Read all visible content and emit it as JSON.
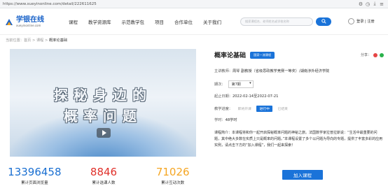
{
  "browser": {
    "url": "https://www.xueyinonline.com/detail/222611625"
  },
  "header": {
    "logo_name": "学银在线",
    "logo_domain": "xueyinonline.com",
    "menu": [
      "课程",
      "教学资源库",
      "示范教学包",
      "项目",
      "合作单位",
      "关于我们"
    ],
    "search_placeholder": "搜索课程名、老师姓名或学校名称",
    "login_label": "登录 | 注册"
  },
  "breadcrumb": {
    "prefix": "当前位置：",
    "path": "首页 > 课程 > ",
    "current": "概率论基础"
  },
  "video": {
    "line1": "探秘身边的",
    "line2": "概率问题"
  },
  "stats": [
    {
      "value": "13396458",
      "label": "累计页面浏览量",
      "color": "#1a6fd1"
    },
    {
      "value": "8846",
      "label": "累计选课人数",
      "color": "#e0312b"
    },
    {
      "value": "71026",
      "label": "累计互动次数",
      "color": "#f5a623"
    }
  ],
  "course": {
    "title": "概率论基础",
    "badge": "国家一流课程",
    "share_label": "分享：",
    "teacher_label": "主讲教师：",
    "teacher_value": "周琴 副教授（省级思政教学竞赛一等奖）/湖南涉外经济学院",
    "term_label": "期次：",
    "term_value": "第7期",
    "date_label": "起止日期：",
    "date_value": "2022-02-14至2022-07-21",
    "status_label": "教学进度：",
    "status_options": [
      "即将开课",
      "进行中",
      "已结束"
    ],
    "status_active_index": 1,
    "hours_label": "学时：",
    "hours_value": "48学时",
    "desc_label": "课程简介：",
    "desc_value": "本课程将和你一起开启探秘概率问题的神秘之旅。法国数学家拉普拉斯说：“生活中最重要的问题，其中绝大多数在实质上只是概率的问题。”本课程设置了多个以问题为导向的专题，提供了丰富多彩的应用实例，请点击下方的“加入课程”，我们一起来探索！",
    "join_label": "加入课程"
  },
  "colors": {
    "accent": "#1a73d9"
  }
}
